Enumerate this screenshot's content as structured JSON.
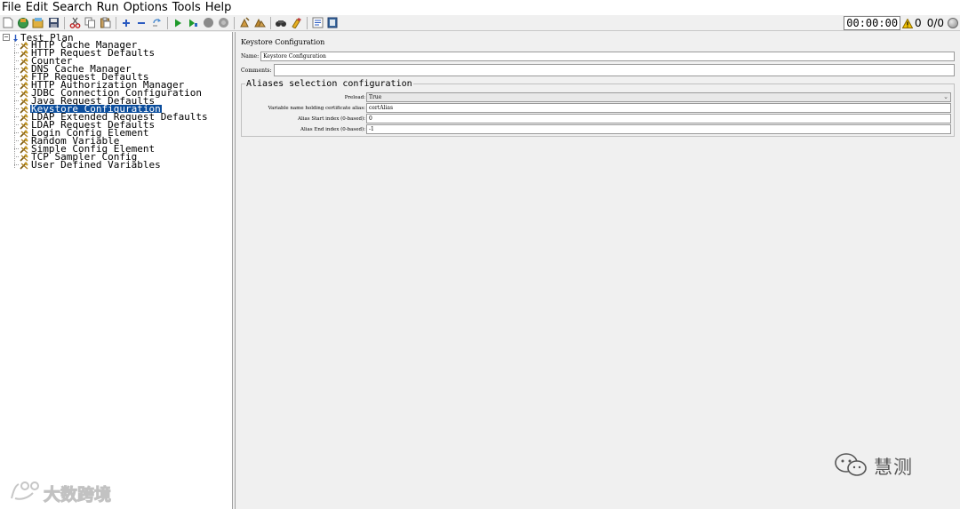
{
  "menu": [
    "File",
    "Edit",
    "Search",
    "Run",
    "Options",
    "Tools",
    "Help"
  ],
  "toolbar": {
    "timer": "00:00:00",
    "warning_count": "0",
    "thread_counts": "0/0"
  },
  "tree": {
    "root": "Test Plan",
    "items": [
      "HTTP Cache Manager",
      "HTTP Request Defaults",
      "Counter",
      "DNS Cache Manager",
      "FTP Request Defaults",
      "HTTP Authorization Manager",
      "JDBC Connection Configuration",
      "Java Request Defaults",
      "Keystore Configuration",
      "LDAP Extended Request Defaults",
      "LDAP Request Defaults",
      "Login Config Element",
      "Random Variable",
      "Simple Config Element",
      "TCP Sampler Config",
      "User Defined Variables"
    ],
    "selected": "Keystore Configuration"
  },
  "config": {
    "title": "Keystore Configuration",
    "name_label": "Name:",
    "name_value": "Keystore Configuration",
    "comments_label": "Comments:",
    "comments_value": "",
    "group_title": "Aliases selection configuration",
    "preload_label": "Preload:",
    "preload_value": "True",
    "variable_label": "Variable name holding certificate alias:",
    "variable_value": "certAlias",
    "start_label": "Alias Start index (0-based):",
    "start_value": "0",
    "end_label": "Alias End index (0-based):",
    "end_value": "-1"
  },
  "watermarks": {
    "left": "大数跨境",
    "right": "慧测"
  },
  "colors": {
    "selection": "#0b4d9c",
    "warning": "#f2c200"
  }
}
